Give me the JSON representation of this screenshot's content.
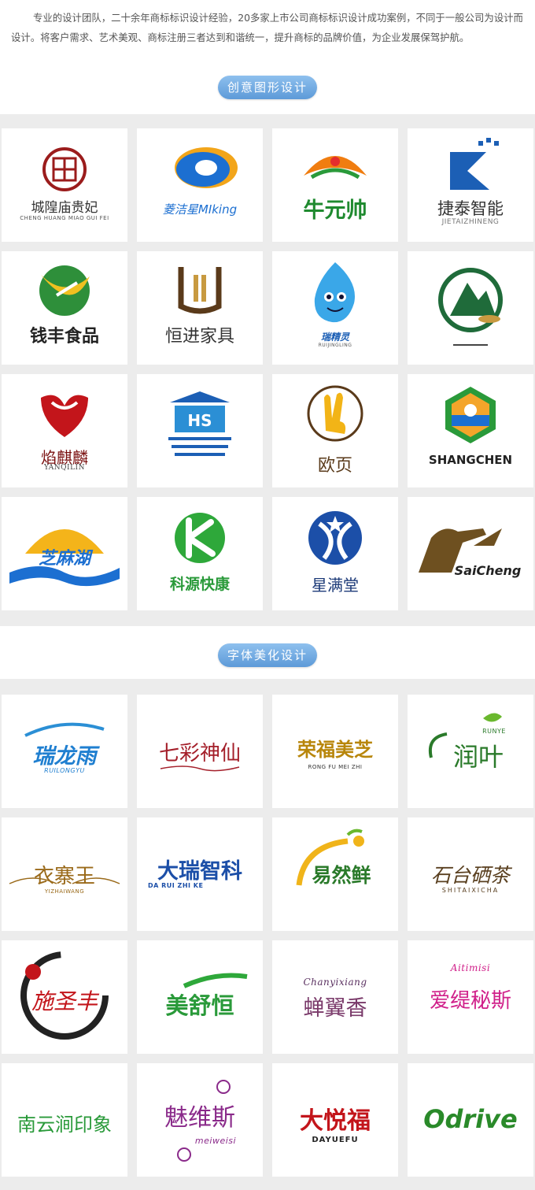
{
  "intro": {
    "text": "专业的设计团队，二十余年商标标识设计经验，20多家上市公司商标标识设计成功案例，不同于一般公司为设计而设计。将客户需求、艺术美观、商标注册三者达到和谐统一，提升商标的品牌价值，为企业发展保驾护航。"
  },
  "section1": {
    "title": "创意图形设计",
    "logos": [
      {
        "name": "城隍庙贵妃",
        "sub": "CHENG HUANG MIAO GUI FEI"
      },
      {
        "name": "菱洁星MIking",
        "sub": ""
      },
      {
        "name": "牛元帅",
        "sub": ""
      },
      {
        "name": "捷泰智能",
        "sub": "JIETAIZHINENG"
      },
      {
        "name": "钱丰食品",
        "sub": ""
      },
      {
        "name": "恒进家具",
        "sub": ""
      },
      {
        "name": "瑞精灵",
        "sub": "RUIJINGLING"
      },
      {
        "name": "",
        "sub": ""
      },
      {
        "name": "焰麒麟",
        "sub": "YANQILIN"
      },
      {
        "name": "",
        "sub": ""
      },
      {
        "name": "欧页",
        "sub": ""
      },
      {
        "name": "SHANGCHEN",
        "sub": ""
      },
      {
        "name": "芝麻湖",
        "sub": ""
      },
      {
        "name": "科源快康",
        "sub": ""
      },
      {
        "name": "星满堂",
        "sub": ""
      },
      {
        "name": "SaiCheng",
        "sub": ""
      }
    ]
  },
  "section2": {
    "title": "字体美化设计",
    "logos": [
      {
        "name": "瑞龙雨",
        "sub": "RUILONGYU"
      },
      {
        "name": "七彩神仙",
        "sub": ""
      },
      {
        "name": "荣福美芝",
        "sub": "RONG FU MEI ZHI"
      },
      {
        "name": "润叶",
        "sub": "RUNYE"
      },
      {
        "name": "衣寨王",
        "sub": "YIZHAIWANG"
      },
      {
        "name": "大瑞智科",
        "sub": "DA RUI ZHI KE"
      },
      {
        "name": "易然鲜",
        "sub": ""
      },
      {
        "name": "石台硒茶",
        "sub": "SHITAIXICHA"
      },
      {
        "name": "施圣丰",
        "sub": ""
      },
      {
        "name": "美舒恒",
        "sub": ""
      },
      {
        "name": "蝉翼香",
        "sub": "Chanyixiang"
      },
      {
        "name": "爱缇秘斯",
        "sub": "Aitimisi"
      },
      {
        "name": "南云涧印象",
        "sub": ""
      },
      {
        "name": "魅维斯",
        "sub": "meiweisi"
      },
      {
        "name": "大悦福",
        "sub": "DAYUEFU"
      },
      {
        "name": "Odrive",
        "sub": ""
      }
    ]
  },
  "colors": {
    "panel": "#ececec",
    "pill": "#6fa8e0"
  }
}
